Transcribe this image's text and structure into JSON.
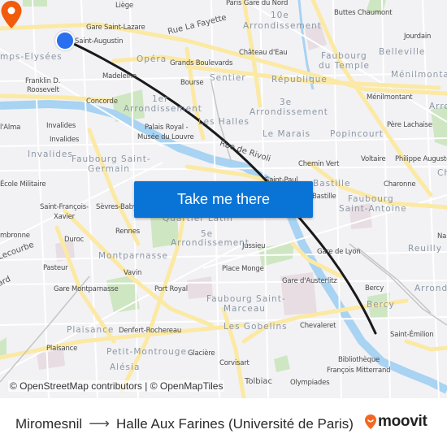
{
  "map": {
    "labels": {
      "liege": "Liège",
      "gare_st_lazare": "Gare Saint-Lazare",
      "saint_augustin": "Saint-Augustin",
      "rue_la_fayette": "Rue La Fayette",
      "paris_gare_du_nord": "Paris Gare du Nord",
      "tenth": "10e",
      "tenth_arr": "Arrondissement",
      "buttes_chaumont": "Buttes Chaumont",
      "jourdain": "Jourdain",
      "chateau_deau": "Château d'Eau",
      "faubourg_temple_1": "Faubourg",
      "faubourg_temple_2": "du Temple",
      "belleville": "Belleville",
      "champs_elysees": "mps-Elysées",
      "opera": "Opéra",
      "grands_boulevards": "Grands Boulevards",
      "sentier": "Sentier",
      "republique": "République",
      "menilmontant_dist": "Ménilmontant",
      "franklin_1": "Franklin D.",
      "franklin_2": "Roosevelt",
      "madeleine": "Madeleine",
      "bourse": "Bourse",
      "menilmontant_stn": "Ménilmontant",
      "concorde": "Concorde",
      "first": "1er",
      "first_arr": "Arrondissement",
      "third": "3e",
      "third_arr": "Arrondissement",
      "arro_right": "Arro",
      "alma": "l'Alma",
      "invalides_1": "Invalides",
      "invalides_2": "Invalides",
      "palais_royal_1": "Palais Royal -",
      "palais_royal_2": "Musée du Louvre",
      "les_halles": "Les Halles",
      "le_marais": "Le Marais",
      "popincourt": "Popincourt",
      "pere_lachaise": "Père Lachaise",
      "invalides_dist": "Invalides",
      "faubourg_sg_1": "Faubourg Saint-",
      "faubourg_sg_2": "Germain",
      "rue_de_rivoli": "Rue de Rivoli",
      "chemin_vert": "Chemin Vert",
      "voltaire": "Voltaire",
      "philippe_auguste": "Philippe Auguste",
      "ch": "Ch",
      "ecole_militaire": "École Militaire",
      "saint_paul": "Saint-Paul",
      "bastille_dist": "Bastille",
      "charonne": "Charonne",
      "bastille_stn": "Bastille",
      "faubourg_sa_1": "Faubourg",
      "faubourg_sa_2": "Saint-Antoine",
      "sfx_1": "Saint-François-",
      "sfx_2": "Xavier",
      "sevres_babylone": "Sèvres-Babylone",
      "quartier_latin": "Quartier Latin",
      "cambronne": "mbronne",
      "rennes": "Rennes",
      "fifth": "5e",
      "fifth_arr": "Arrondissement",
      "na": "Na",
      "duroc": "Duroc",
      "jussieu": "Jussieu",
      "gare_de_lyon": "Gare de Lyon",
      "reuilly": "Reuilly",
      "lecourbe": "Lecourbe",
      "montparnasse": "Montparnasse",
      "pasteur": "Pasteur",
      "place_monge": "Place Monge",
      "vavin": "Vavin",
      "gare_austerlitz": "Gare d'Austerlitz",
      "ard": "ard",
      "gare_montparnasse": "Gare Montparnasse",
      "port_royal": "Port Royal",
      "bercy_stn": "Bercy",
      "arrondi_right": "Arrondi",
      "faubourg_sm_1": "Faubourg Saint-",
      "faubourg_sm_2": "Marceau",
      "bercy_dist": "Bercy",
      "plaisance_dist": "Plaisance",
      "denfert": "Denfert-Rochereau",
      "chevaleret": "Chevaleret",
      "les_gobelins": "Les Gobelins",
      "saint_emilion": "Saint-Émilion",
      "plaisance_stn": "Plaisance",
      "petit_montrouge": "Petit-Montrouge",
      "glaciere": "Glacière",
      "bfm_1": "Bibliothèque",
      "bfm_2": "François Mitterrand",
      "alesia": "Alésia",
      "corvisart": "Corvisart",
      "tolbiac": "Tolbiac",
      "olympiades": "Olympiades"
    },
    "origin_marker_color": "#2a6ff0",
    "destination_marker_color": "#f25a0c",
    "route_color": "#1a1a1a",
    "attribution": "© OpenStreetMap contributors | © OpenMapTiles"
  },
  "cta": {
    "label": "Take me there",
    "color": "#0a74d6"
  },
  "footer": {
    "origin": "Miromesnil",
    "arrow": "⟶",
    "destination": "Halle Aux Farines (Université de Paris)",
    "brand": "moovit",
    "brand_color": "#f26722"
  }
}
